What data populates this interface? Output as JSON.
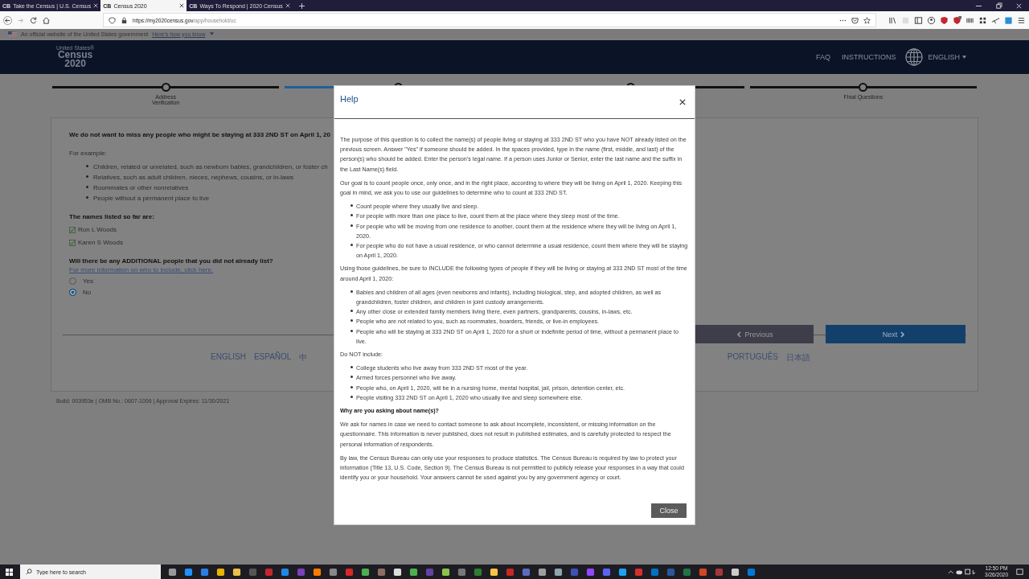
{
  "browser": {
    "tabs": [
      {
        "title": "Take the Census | U.S. Census",
        "badge": "CB",
        "selected": false
      },
      {
        "title": "Census 2020",
        "badge": "CB",
        "selected": true
      },
      {
        "title": "Ways To Respond | 2020 Census",
        "badge": "CB",
        "selected": false
      }
    ],
    "url": {
      "host": "https://my2020census.gov",
      "path": "/app/household/uc"
    }
  },
  "gov_banner": {
    "text": "An official website of the United States government",
    "link": "Here's how you know"
  },
  "header": {
    "logo": {
      "small": "United States®",
      "line1": "Census",
      "line2": "2020"
    },
    "nav": [
      "FAQ",
      "INSTRUCTIONS"
    ],
    "language": "ENGLISH"
  },
  "progress": [
    {
      "label": "Address Verification",
      "current": false
    },
    {
      "current": true
    },
    {
      "current": false
    },
    {
      "label": "Final Questions",
      "current": false
    }
  ],
  "form": {
    "question": "We do not want to miss any people who might be staying at 333 2ND ST on April 1, 20",
    "example_label": "For example:",
    "examples": [
      "Children, related or unrelated, such as newborn babies, grandchildren, or foster ch",
      "Relatives, such as adult children, nieces, nephews, cousins, or in-laws",
      "Roommates or other nonrelatives",
      "People without a permanent place to live"
    ],
    "names_heading": "The names listed so far are:",
    "names": [
      {
        "name": "Ron L Woods",
        "checked": true
      },
      {
        "name": "Karen S Woods",
        "checked": true
      }
    ],
    "question2": "Will there be any ADDITIONAL people that you did not already list?",
    "info_link": "For more information on who to include, click here.",
    "options": [
      {
        "label": "Yes",
        "selected": false
      },
      {
        "label": "No",
        "selected": true
      }
    ],
    "previous": "Previous",
    "next": "Next",
    "languages_left": [
      "ENGLISH",
      "ESPAÑOL",
      "中"
    ],
    "languages_right": [
      "PORTUGUÊS",
      "日本語"
    ]
  },
  "build": "Build: 003953e | OMB No.: 0607-1006 | Approval Expires: 11/30/2021",
  "modal": {
    "title": "Help",
    "close": "Close",
    "blocks": [
      {
        "kind": "p",
        "text": "The purpose of this question is to collect the name(s) of people living or staying at 333 2ND ST who you have NOT already listed on the previous screen. Answer \"Yes\" if someone should be added. In the spaces provided, type in the name (first, middle, and last) of the person(s) who should be added. Enter the person's legal name. If a person uses Junior or Senior, enter the last name and the suffix in the Last Name(s) field."
      },
      {
        "kind": "p",
        "text": "Our goal is to count people once, only once, and in the right place, according to where they will be living on April 1, 2020. Keeping this goal in mind, we ask you to use our guidelines to determine who to count at 333 2ND ST."
      },
      {
        "kind": "list",
        "items": [
          "Count people where they usually live and sleep.",
          "For people with more than one place to live, count them at the place where they sleep most of the time.",
          "For people who will be moving from one residence to another, count them at the residence where they will be living on April 1, 2020.",
          "For people who do not have a usual residence, or who cannot determine a usual residence, count them where they will be staying on April 1, 2020."
        ]
      },
      {
        "kind": "p",
        "text": "Using those guidelines, be sure to INCLUDE the following types of people if they will be living or staying at 333 2ND ST most of the time around April 1, 2020:"
      },
      {
        "kind": "list",
        "items": [
          "Babies and children of all ages (even newborns and infants), including biological, step, and adopted children, as well as grandchildren, foster children, and children in joint custody arrangements.",
          "Any other close or extended family members living there, even partners, grandparents, cousins, in-laws, etc.",
          "People who are not related to you, such as roommates, boarders, friends, or live-in employees.",
          "People who will be staying at 333 2ND ST on April 1, 2020 for a short or indefinite period of time, without a permanent place to live."
        ]
      },
      {
        "kind": "p",
        "text": "Do NOT include:"
      },
      {
        "kind": "list",
        "items": [
          "College students who live away from 333 2ND ST most of the year.",
          "Armed forces personnel who live away.",
          "People who, on April 1, 2020, will be in a nursing home, mental hospital, jail, prison, detention center, etc.",
          "People visiting 333 2ND ST on April 1, 2020 who usually live and sleep somewhere else."
        ]
      },
      {
        "kind": "heading",
        "text": "Why are you asking about name(s)?"
      },
      {
        "kind": "p",
        "text": "We ask for names in case we need to contact someone to ask about incomplete, inconsistent, or missing information on the questionnaire. This information is never published, does not result in published estimates, and is carefully protected to respect the personal information of respondents."
      },
      {
        "kind": "p",
        "text": "By law, the Census Bureau can only use your responses to produce statistics. The Census Bureau is required by law to protect your information (Title 13, U.S. Code, Section 9). The Census Bureau is not permitted to publicly release your responses in a way that could identify you or your household. Your answers cannot be used against you by any government agency or court."
      }
    ]
  },
  "taskbar": {
    "search_placeholder": "Type here to search",
    "time": "12:50 PM",
    "date": "3/26/2020"
  }
}
